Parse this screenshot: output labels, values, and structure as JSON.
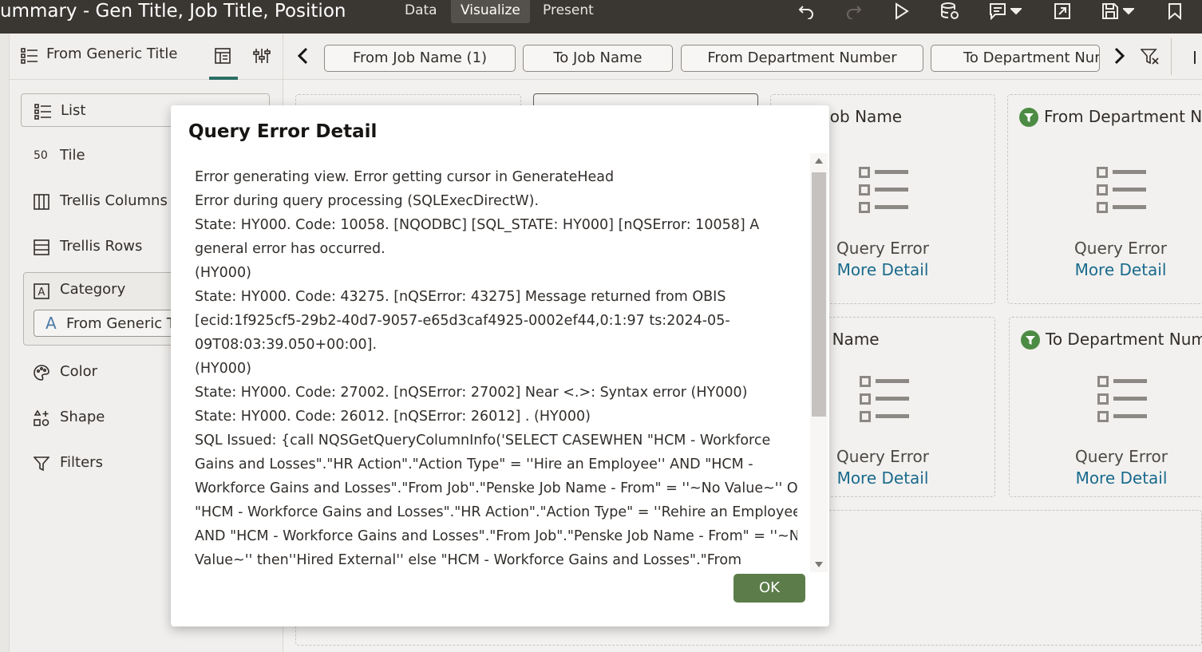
{
  "app": {
    "title": "ummary - Gen Title, Job Title, Position",
    "tabs": [
      {
        "label": "Data",
        "active": false
      },
      {
        "label": "Visualize",
        "active": true
      },
      {
        "label": "Present",
        "active": false
      }
    ],
    "toolbar_icons": [
      "undo-icon",
      "redo-icon",
      "run-icon",
      "data-refresh-icon",
      "comment-icon",
      "export-icon",
      "save-icon",
      "bookmark-icon"
    ]
  },
  "left_panel": {
    "header_label": "From Generic Title",
    "grammar": [
      {
        "label": "List",
        "icon": "list-icon"
      },
      {
        "label": "Tile",
        "icon": "tile-icon"
      },
      {
        "label": "Trellis Columns",
        "icon": "trellis-columns-icon"
      },
      {
        "label": "Trellis Rows",
        "icon": "trellis-rows-icon"
      },
      {
        "label": "Category",
        "icon": "category-icon"
      },
      {
        "label": "Color",
        "icon": "palette-icon"
      },
      {
        "label": "Shape",
        "icon": "shape-icon"
      },
      {
        "label": "Filters",
        "icon": "filter-icon"
      }
    ],
    "tile_icon_glyph": "50",
    "category_glyph": "A",
    "category_item": "From Generic Title",
    "category_item_glyph": "A"
  },
  "filter_bar": {
    "chips": [
      "From Job Name (1)",
      "To Job Name",
      "From Department Number",
      "To Department Number"
    ]
  },
  "canvas": {
    "tiles": [
      {
        "title": "From Job Name",
        "error": "Query Error",
        "more": "More Detail",
        "filtered": false
      },
      {
        "title": "From Department Number",
        "error": "Query Error",
        "more": "More Detail",
        "filtered": true
      },
      {
        "title": "To Job Name",
        "error": "Query Error",
        "more": "More Detail",
        "filtered": false
      },
      {
        "title": "To Department Number",
        "error": "Query Error",
        "more": "More Detail",
        "filtered": true
      }
    ]
  },
  "modal": {
    "title": "Query Error Detail",
    "lines": [
      "Error generating view. Error getting cursor in GenerateHead",
      "Error during query processing (SQLExecDirectW).",
      "State: HY000. Code: 10058. [NQODBC] [SQL_STATE: HY000] [nQSError: 10058] A",
      "general error has occurred.",
      "(HY000)",
      "State: HY000. Code: 43275. [nQSError: 43275] Message returned from OBIS",
      "[ecid:1f925cf5-29b2-40d7-9057-e65d3caf4925-0002ef44,0:1:97 ts:2024-05-",
      "09T08:03:39.050+00:00].",
      "(HY000)",
      "State: HY000. Code: 27002. [nQSError: 27002] Near <.>: Syntax error (HY000)",
      "State: HY000. Code: 26012. [nQSError: 26012] . (HY000)",
      "SQL Issued: {call NQSGetQueryColumnInfo('SELECT CASEWHEN \"HCM - Workforce",
      "Gains and Losses\".\"HR Action\".\"Action Type\" = ''Hire an Employee'' AND \"HCM -",
      "Workforce Gains and Losses\".\"From Job\".\"Penske Job Name - From\" = ''~No Value~'' OR",
      "\"HCM - Workforce Gains and Losses\".\"HR Action\".\"Action Type\" = ''Rehire an Employee''",
      "AND \"HCM - Workforce Gains and Losses\".\"From Job\".\"Penske Job Name - From\" = ''~No",
      "Value~'' then''Hired External'' else \"HCM - Workforce Gains and Losses\".\"From"
    ],
    "ok_label": "OK"
  }
}
